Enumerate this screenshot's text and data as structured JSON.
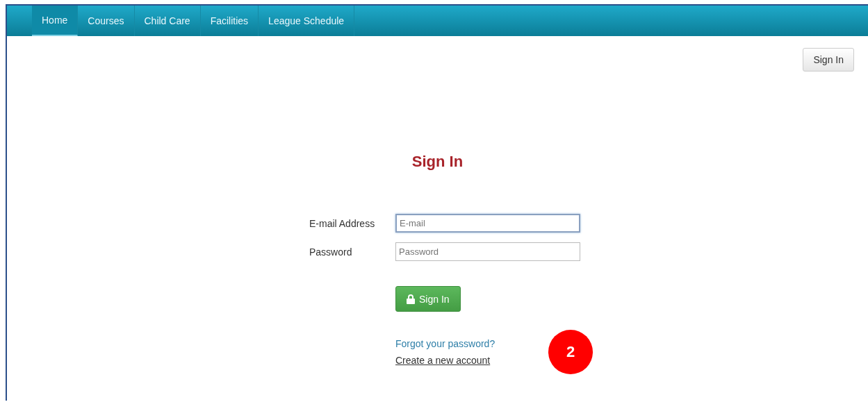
{
  "nav": {
    "items": [
      {
        "label": "Home",
        "selected": true
      },
      {
        "label": "Courses",
        "selected": false
      },
      {
        "label": "Child Care",
        "selected": false
      },
      {
        "label": "Facilities",
        "selected": false
      },
      {
        "label": "League Schedule",
        "selected": false
      }
    ]
  },
  "header_button": "Sign In",
  "form": {
    "title": "Sign In",
    "fields": [
      {
        "label": "E-mail Address",
        "placeholder": "E-mail",
        "focused": true
      },
      {
        "label": "Password",
        "placeholder": "Password",
        "focused": false
      }
    ],
    "submit": "Sign In",
    "links": [
      {
        "text": "Forgot your password?",
        "kind": "plain"
      },
      {
        "text": "Create a new account",
        "kind": "underlined"
      }
    ]
  },
  "callout": "2"
}
